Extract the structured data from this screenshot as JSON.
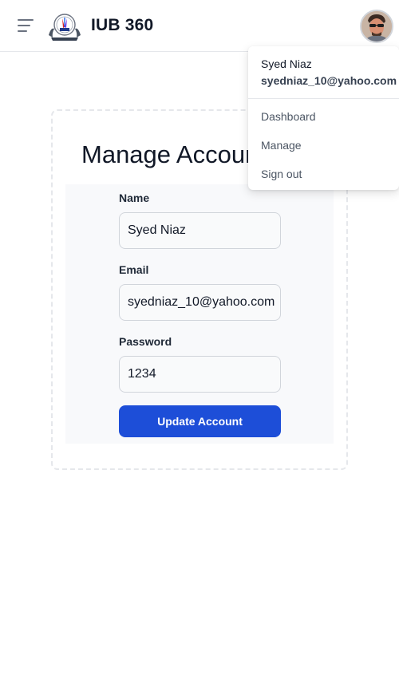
{
  "navbar": {
    "brand": "IUB 360",
    "menu_icon": "hamburger-menu-icon",
    "logo_icon": "iub-logo-icon",
    "avatar_icon": "user-avatar-icon"
  },
  "dropdown": {
    "user_name": "Syed Niaz",
    "user_email": "syedniaz_10@yahoo.com",
    "items": [
      "Dashboard",
      "Manage",
      "Sign out"
    ]
  },
  "page": {
    "title": "Manage Account"
  },
  "form": {
    "name_label": "Name",
    "name_value": "Syed Niaz",
    "email_label": "Email",
    "email_value": "syedniaz_10@yahoo.com",
    "password_label": "Password",
    "password_value": "1234",
    "submit_label": "Update Account"
  },
  "colors": {
    "accent": "#1d4ed8",
    "border": "#e5e7eb",
    "panel": "#f8f9fb"
  }
}
